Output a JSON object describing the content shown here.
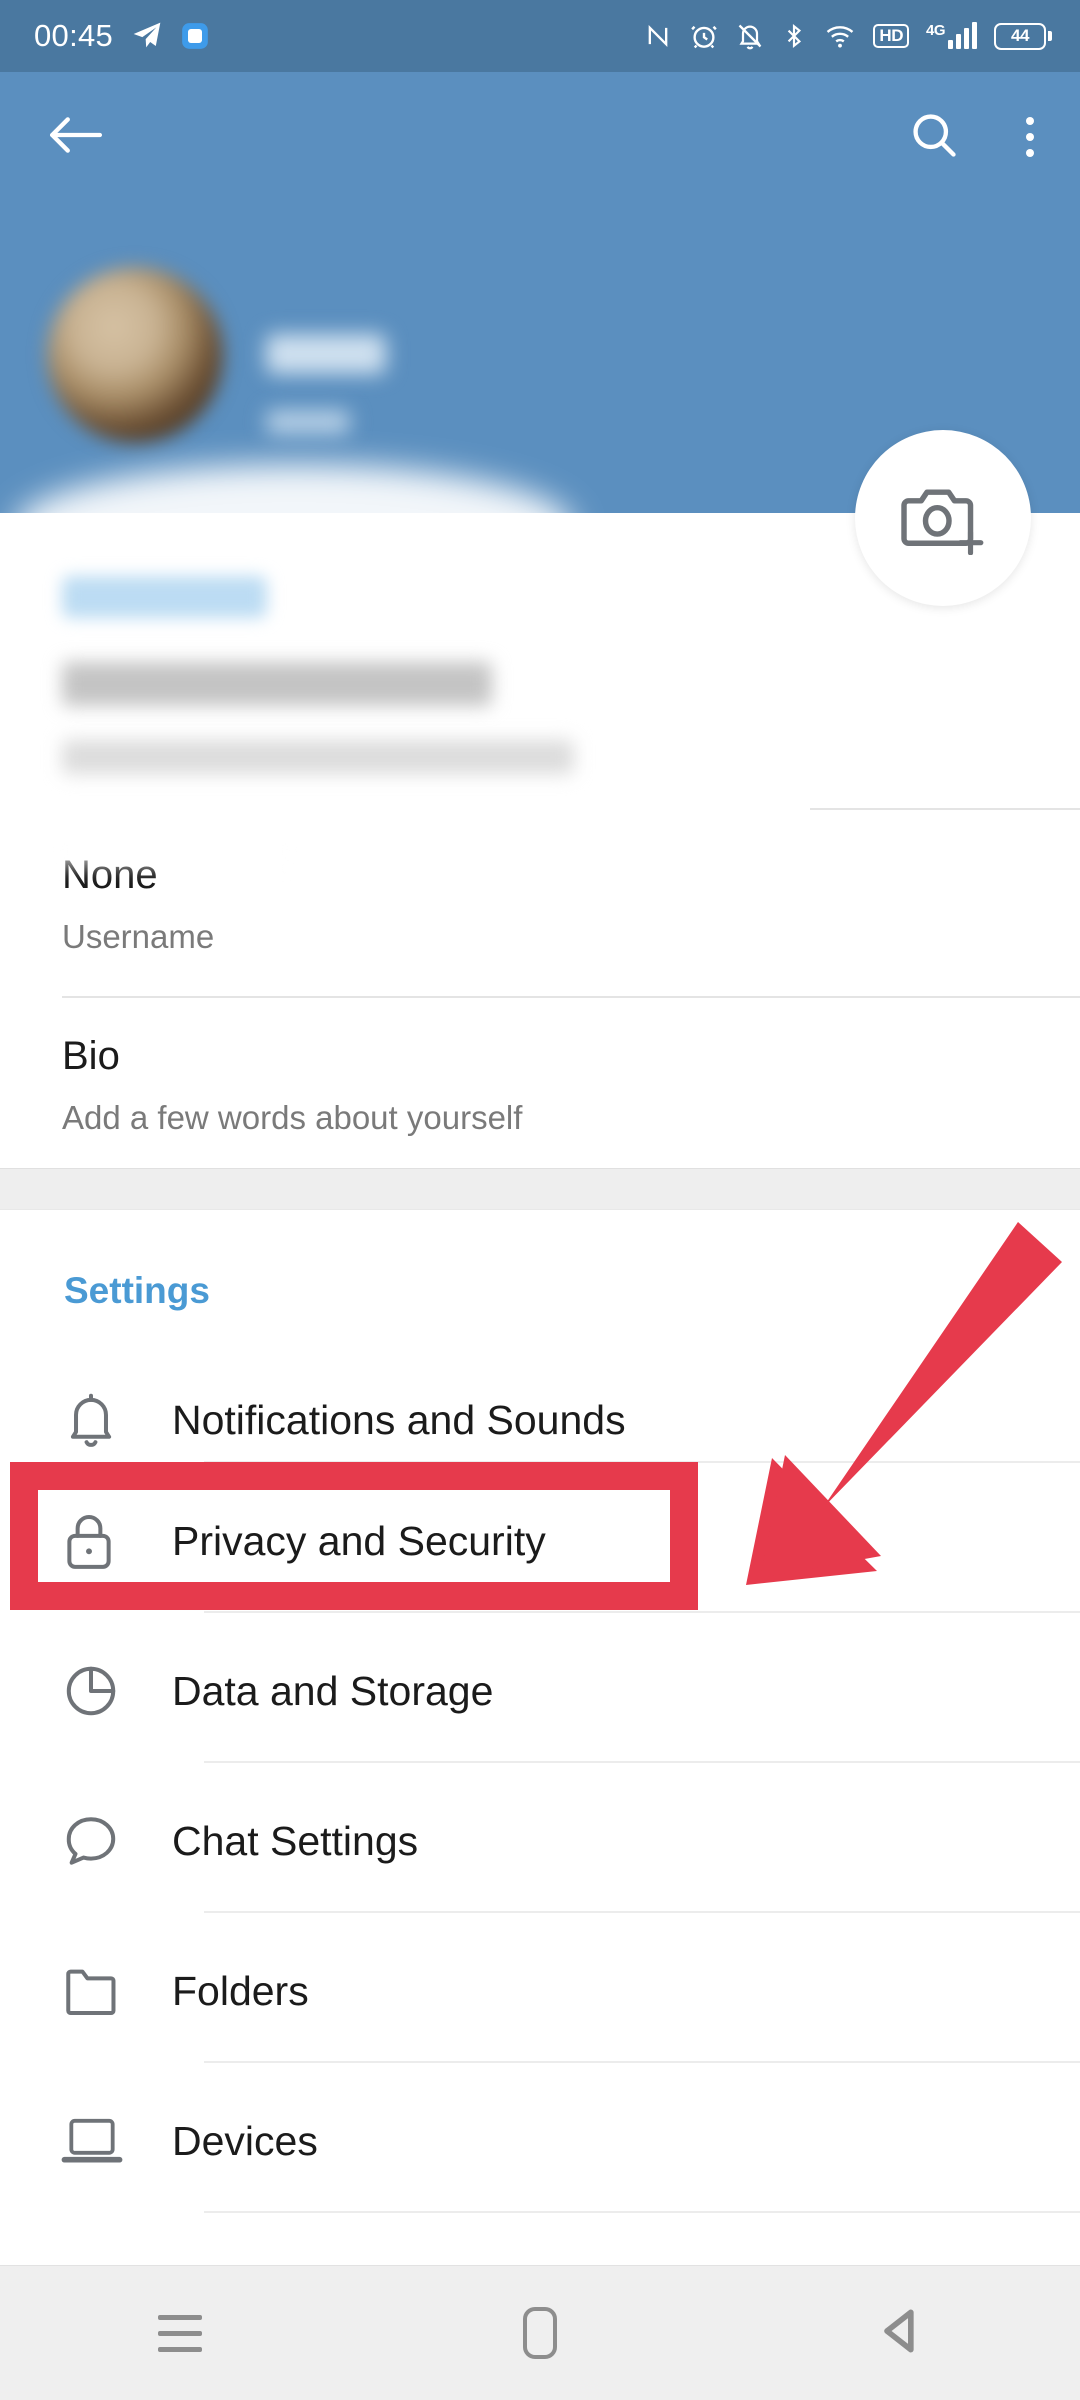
{
  "status_bar": {
    "time": "00:45",
    "left_icons": [
      "telegram-send-icon",
      "app-notification-icon"
    ],
    "right_icons": [
      "nfc-icon",
      "alarm-icon",
      "bell-muted-icon",
      "bluetooth-icon",
      "wifi-icon",
      "hd-icon",
      "signal-4g-icon",
      "battery-icon"
    ],
    "hd_label": "HD",
    "network_label": "4G",
    "battery_level": "44"
  },
  "toolbar": {
    "back_icon": "back-arrow-icon",
    "search_icon": "search-icon",
    "menu_icon": "overflow-menu-icon"
  },
  "profile": {
    "avatar": "user-avatar-redacted",
    "name": "",
    "status": "",
    "camera_fab_icon": "add-photo-icon",
    "account_label": "",
    "phone_number": "",
    "phone_hint": ""
  },
  "fields": [
    {
      "value": "None",
      "label": "Username",
      "name": "username-field"
    },
    {
      "value": "Bio",
      "label": "Add a few words about yourself",
      "name": "bio-field"
    }
  ],
  "settings": {
    "title": "Settings",
    "accent_color": "#4a9ad4",
    "items": [
      {
        "label": "Notifications and Sounds",
        "icon": "bell-icon"
      },
      {
        "label": "Privacy and Security",
        "icon": "lock-icon"
      },
      {
        "label": "Data and Storage",
        "icon": "pie-chart-icon"
      },
      {
        "label": "Chat Settings",
        "icon": "chat-bubble-icon"
      },
      {
        "label": "Folders",
        "icon": "folder-icon"
      },
      {
        "label": "Devices",
        "icon": "laptop-icon"
      }
    ]
  },
  "annotation": {
    "highlight_color": "#E63A4C",
    "highlight_target": "Privacy and Security",
    "arrow": "red-arrow-pointing-down-left"
  },
  "nav_bar": {
    "buttons": [
      "recents-button",
      "home-button",
      "back-button"
    ]
  },
  "theme": {
    "header_blue": "#5B8FBF",
    "status_blue": "#4A78A0",
    "text_primary": "#1b1b1b",
    "text_secondary": "#7a7a7a"
  }
}
